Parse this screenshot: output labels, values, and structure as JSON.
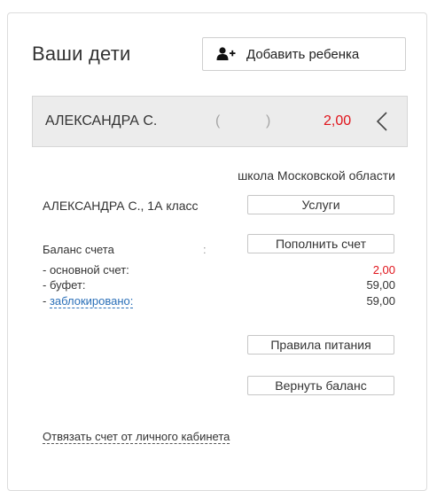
{
  "header": {
    "title": "Ваши дети",
    "add_child_label": "Добавить ребенка"
  },
  "child": {
    "name": "АЛЕКСАНДРА С.",
    "paren_open": "(",
    "paren_close": ")",
    "balance": "2,00"
  },
  "details": {
    "school": "школа Московской области",
    "student": "АЛЕКСАНДРА С., 1А класс",
    "services_label": "Услуги",
    "balance_label": "Баланс счета",
    "balance_colon": ":",
    "topup_label": "Пополнить счет",
    "rows": [
      {
        "label": "- основной счет:",
        "value": "2,00"
      },
      {
        "label": "- буфет:",
        "value": "59,00"
      },
      {
        "label_prefix": "- ",
        "label_link": "заблокировано:",
        "value": "59,00"
      }
    ],
    "rules_label": "Правила питания",
    "return_label": "Вернуть баланс",
    "unlink_label": "Отвязать счет от личного кабинета"
  },
  "colors": {
    "accent_red": "#e0141b",
    "link_blue": "#2a6fb8",
    "header_bg": "#ececec"
  },
  "icons": {
    "add_user": "add-user-icon",
    "collapse": "chevron-left-icon"
  }
}
